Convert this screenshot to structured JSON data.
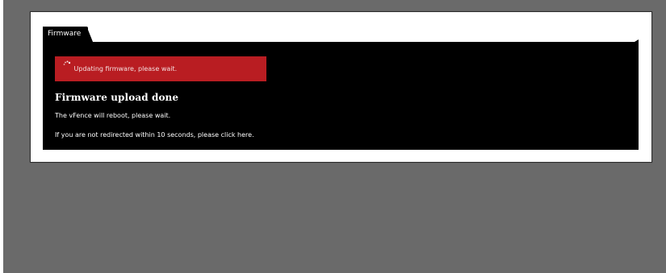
{
  "tab": {
    "label": "Firmware"
  },
  "alert": {
    "icon": "spinner-icon",
    "message": "Updating firmware, please wait."
  },
  "main": {
    "heading": "Firmware upload done",
    "reboot_text": "The vFence will reboot, please wait.",
    "redirect_prefix": "If you are not redirected within 10 seconds, please ",
    "redirect_link": "click here",
    "redirect_suffix": "."
  },
  "colors": {
    "backdrop": "#6a6a6a",
    "panel": "#ffffff",
    "content_bg": "#000000",
    "alert_bg": "#b91d22"
  }
}
